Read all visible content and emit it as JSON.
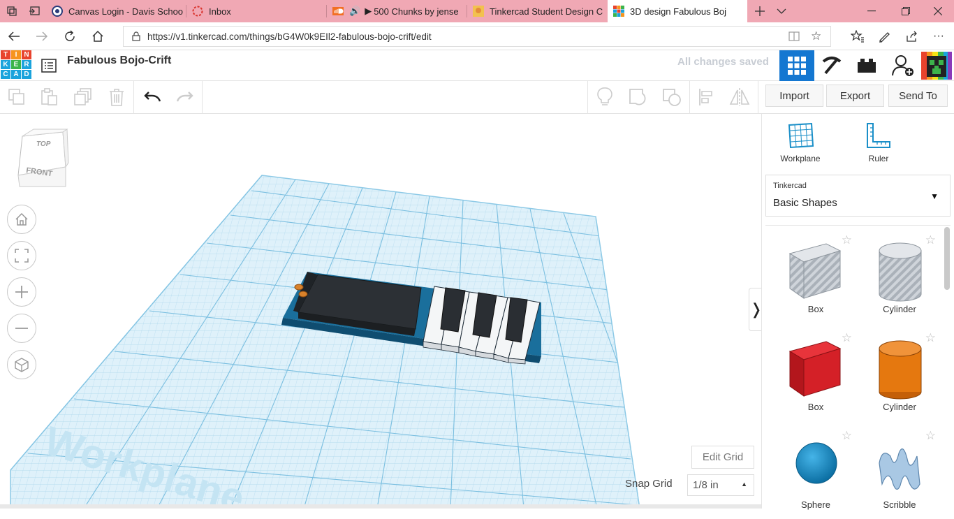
{
  "browser": {
    "tabs": [
      {
        "title": "Canvas Login - Davis Schoo",
        "active": false
      },
      {
        "title": "Inbox",
        "active": false
      },
      {
        "title": "500 Chunks by jense",
        "audio": true,
        "active": false
      },
      {
        "title": "Tinkercad Student Design C",
        "active": false
      },
      {
        "title": "3D design Fabulous Boj",
        "active": true
      }
    ],
    "url": "https://v1.tinkercad.com/things/bG4W0k9EIl2-fabulous-bojo-crift/edit"
  },
  "app": {
    "logo_letters": [
      "T",
      "I",
      "N",
      "K",
      "E",
      "R",
      "C",
      "A",
      "D"
    ],
    "logo_colors": [
      "#e8432d",
      "#f7941d",
      "#e8432d",
      "#1aa3dc",
      "#3cb44b",
      "#1aa3dc",
      "#1aa3dc",
      "#1aa3dc",
      "#1aa3dc"
    ],
    "design_title": "Fabulous Bojo-Crift",
    "save_status": "All changes saved",
    "accent": "#1477d1"
  },
  "toolbar": {
    "import_label": "Import",
    "export_label": "Export",
    "sendto_label": "Send To"
  },
  "viewcube": {
    "top_label": "TOP",
    "front_label": "FRONT"
  },
  "canvas": {
    "workplane_text": "Workplane",
    "edit_grid_label": "Edit Grid",
    "snap_grid_label": "Snap Grid",
    "snap_grid_value": "1/8 in"
  },
  "panel": {
    "workplane_label": "Workplane",
    "ruler_label": "Ruler",
    "library_source": "Tinkercad",
    "library_name": "Basic Shapes",
    "shapes": [
      {
        "label": "Box",
        "kind": "box-hole",
        "color": "#b9bfc7"
      },
      {
        "label": "Cylinder",
        "kind": "cylinder-hole",
        "color": "#b9bfc7"
      },
      {
        "label": "Box",
        "kind": "box",
        "color": "#d42027"
      },
      {
        "label": "Cylinder",
        "kind": "cylinder",
        "color": "#e5780f"
      },
      {
        "label": "Sphere",
        "kind": "sphere",
        "color": "#1596d2"
      },
      {
        "label": "Scribble",
        "kind": "scribble",
        "color": "#8fb6d8"
      }
    ]
  }
}
